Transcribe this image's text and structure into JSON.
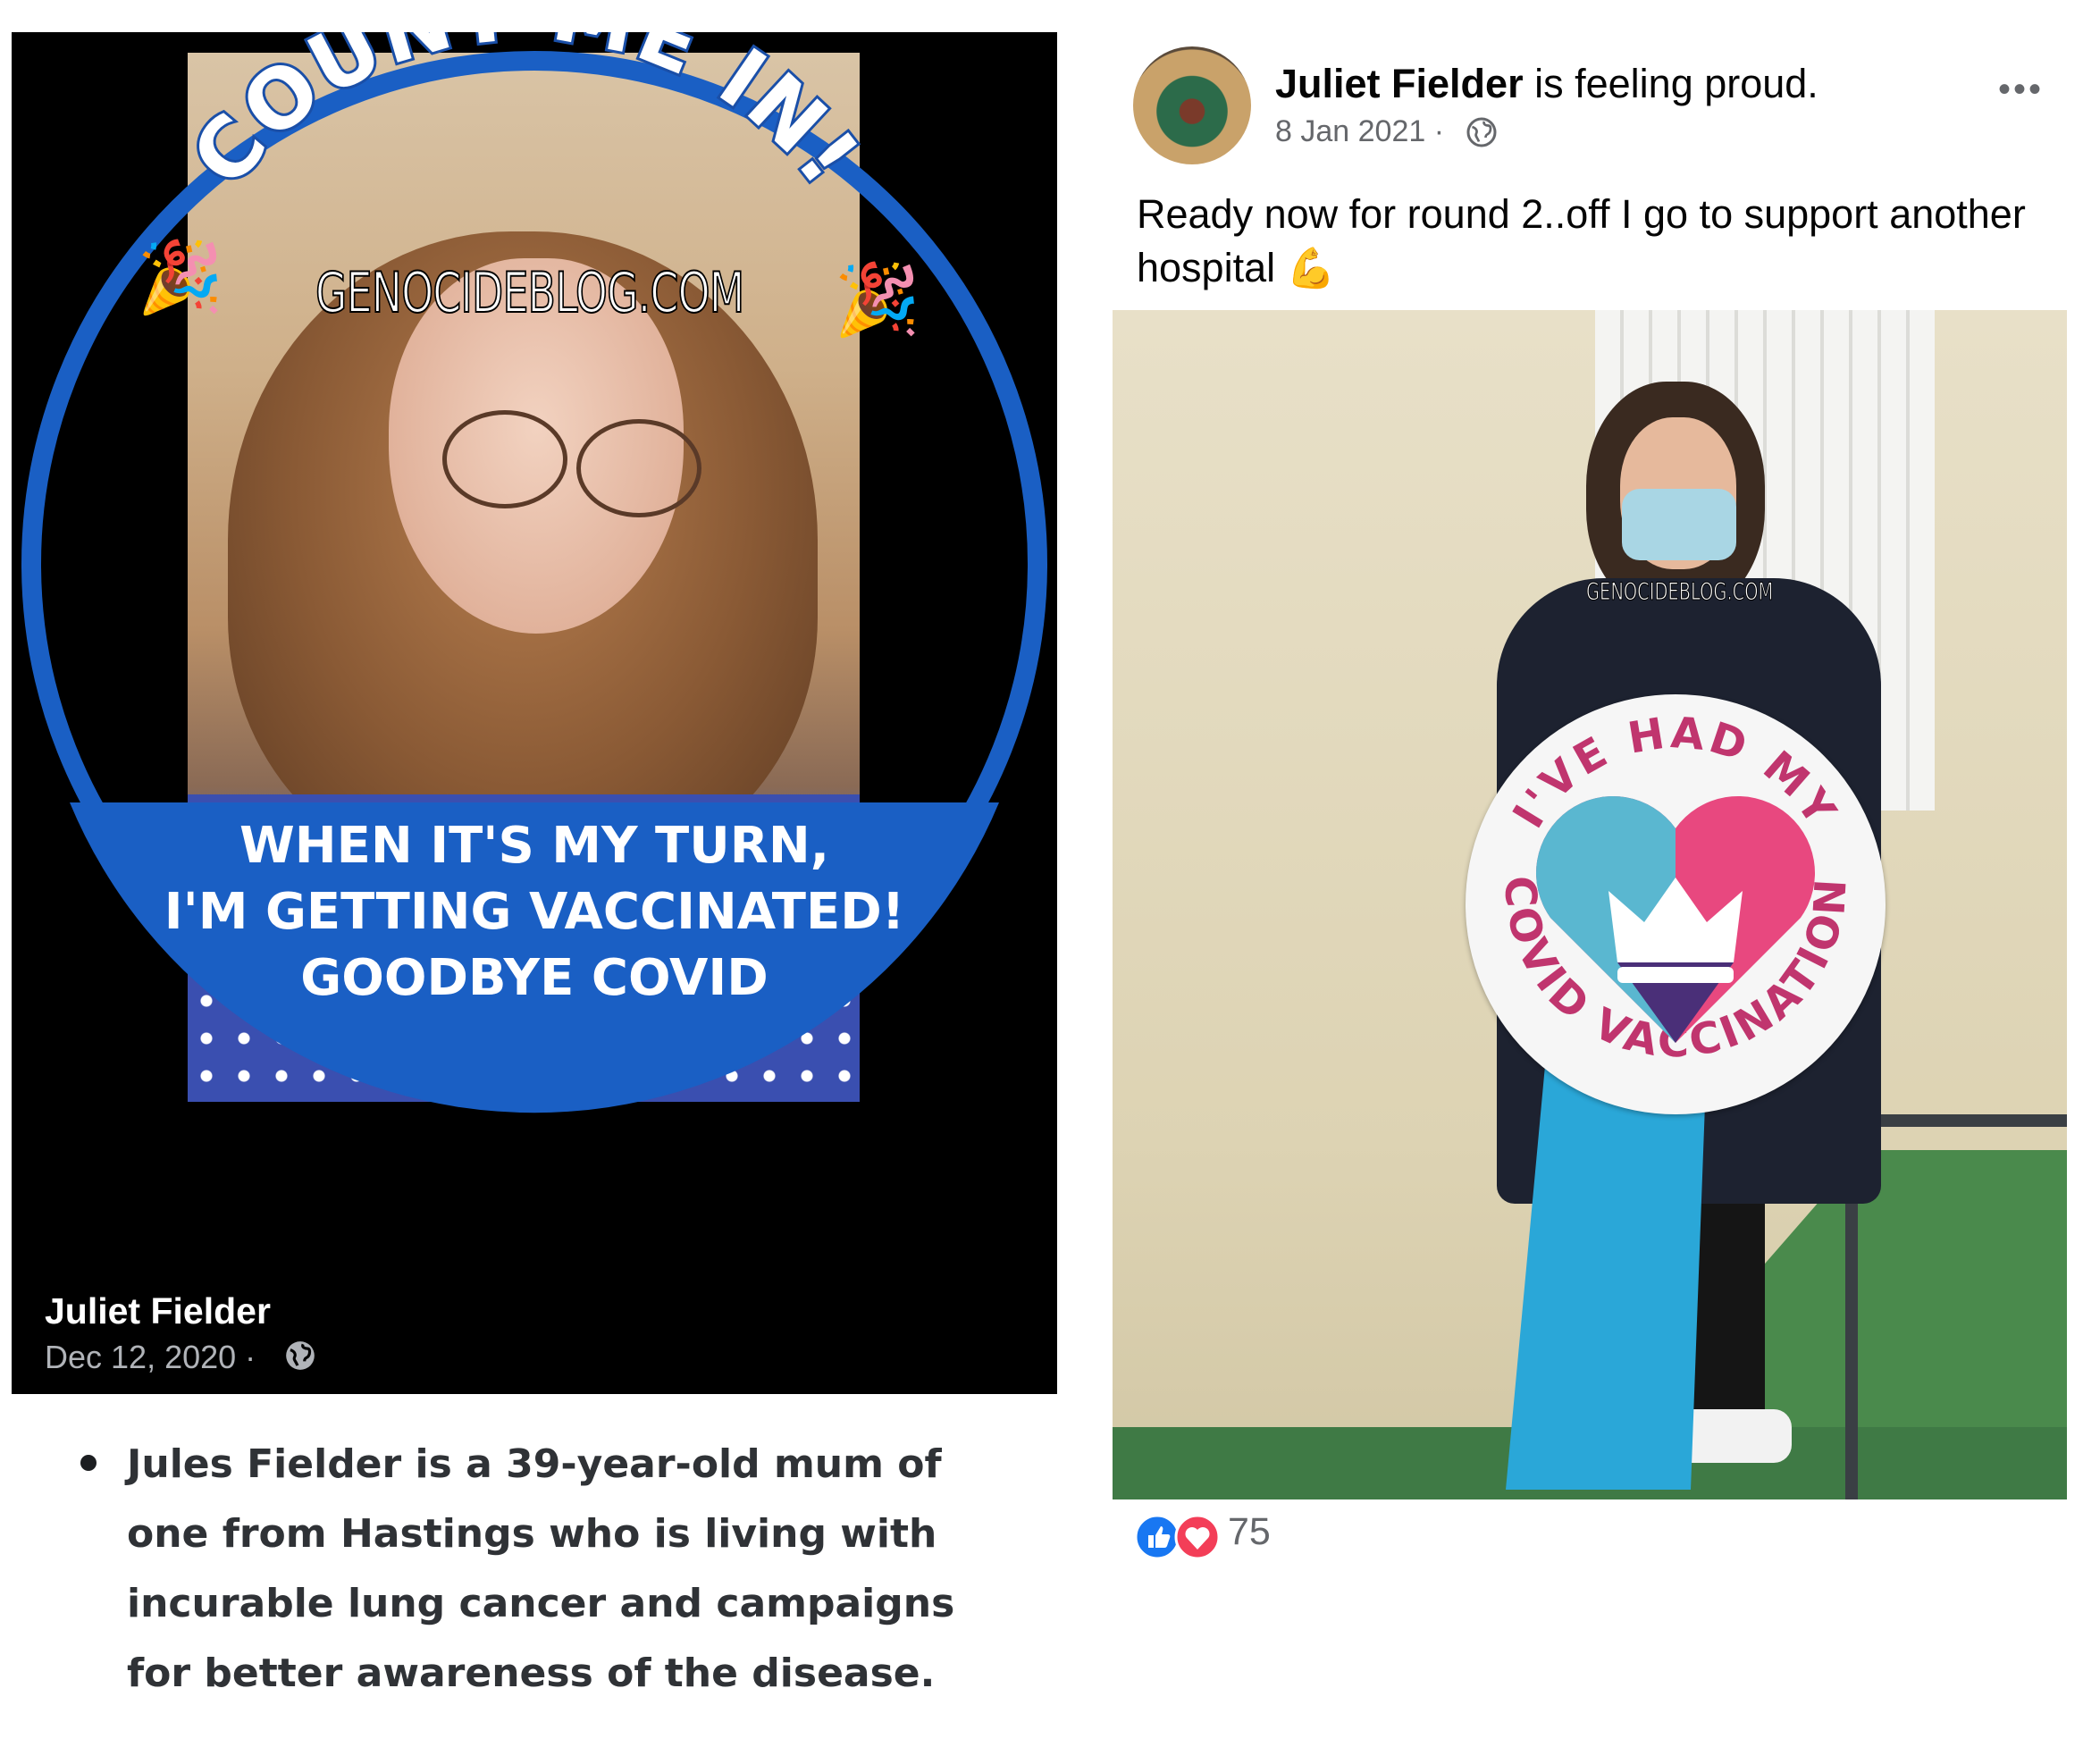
{
  "left_post": {
    "frame_arc_text": "COUNT ME IN!",
    "watermark": "GENOCIDEBLOG.COM",
    "banner_lines": [
      "WHEN IT'S MY TURN,",
      "I'M GETTING VACCINATED!",
      "GOODBYE COVID"
    ],
    "author": "Juliet Fielder",
    "date": "Dec 12, 2020",
    "privacy_icon": "globe-icon",
    "frame_color": "#1a5fc4",
    "decor_icons": [
      "party-popper-icon",
      "party-popper-icon"
    ]
  },
  "bullet": {
    "text": "Jules Fielder is a 39-year-old mum of one from Hastings who is living with incurable lung cancer and campaigns for better awareness of the disease."
  },
  "right_post": {
    "author": "Juliet Fielder",
    "status": "is feeling proud.",
    "date": "8 Jan 2021",
    "separator": "·",
    "privacy_icon": "globe-icon",
    "more_icon": "more-options-icon",
    "text": "Ready now for round 2..off I go to support another hospital",
    "text_emoji": "flexed-biceps-icon",
    "photo_watermark": "GENOCIDEBLOG.COM",
    "sign_top_text": "I'VE HAD MY",
    "sign_bottom_text": "COVID VACCINATION",
    "reactions": [
      "like-icon",
      "love-icon"
    ],
    "reaction_count": "75",
    "like_color": "#1877f2",
    "love_color": "#f33e58"
  }
}
